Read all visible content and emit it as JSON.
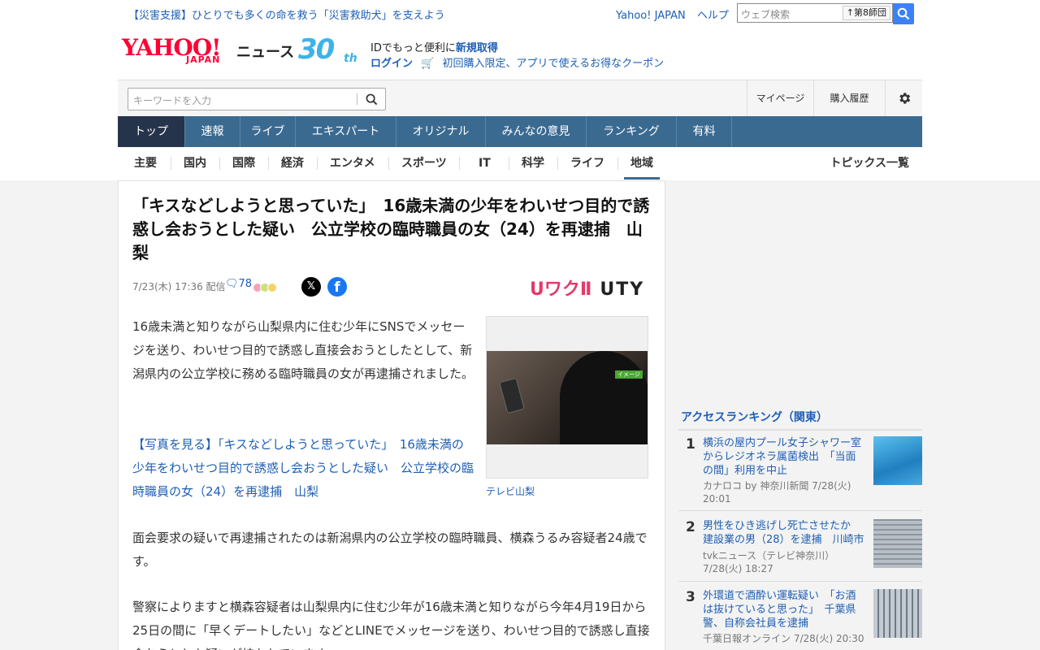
{
  "top_strip": {
    "disaster_link": "【災害支援】ひとりでも多くの命を救う「災害救助犬」を支えよう",
    "yahoo_japan_link": "Yahoo! JAPAN",
    "help_link": "ヘルプ",
    "web_search_placeholder": "ウェブ検索",
    "search_badge": "第8師団"
  },
  "logo": {
    "yahoo": "YAHOO!",
    "japan": "JAPAN",
    "news": "ニュース",
    "anniv_number": "30",
    "anniv_suffix": "th"
  },
  "account": {
    "id_text": "IDでもっと便利に",
    "new_register": "新規取得",
    "login": "ログイン",
    "coupon": "初回購入限定、アプリで使えるお得なクーポン"
  },
  "search_row": {
    "keyword_placeholder": "キーワードを入力",
    "mypage": "マイページ",
    "purchase_history": "購入履歴"
  },
  "main_nav": {
    "items": [
      {
        "label": "トップ",
        "active": true
      },
      {
        "label": "速報"
      },
      {
        "label": "ライブ"
      },
      {
        "label": "エキスパート"
      },
      {
        "label": "オリジナル"
      },
      {
        "label": "みんなの意見"
      },
      {
        "label": "ランキング"
      },
      {
        "label": "有料"
      }
    ]
  },
  "sub_nav": {
    "items": [
      {
        "label": "主要"
      },
      {
        "label": "国内"
      },
      {
        "label": "国際"
      },
      {
        "label": "経済"
      },
      {
        "label": "エンタメ"
      },
      {
        "label": "スポーツ"
      },
      {
        "label": "IT"
      },
      {
        "label": "科学"
      },
      {
        "label": "ライフ"
      },
      {
        "label": "地域",
        "active": true
      }
    ],
    "topics": "トピックス一覧"
  },
  "article": {
    "headline": "「キスなどしようと思っていた」　16歳未満の少年をわいせつ目的で誘惑し会おうとした疑い　公立学校の臨時職員の女（24）を再逮捕　山梨",
    "date": "7/23(木) 17:36",
    "distributed": "配信",
    "comment_count": "78",
    "provider_logo_a": "UワクⅡ",
    "provider_logo_b": "UTY",
    "paragraph1": "16歳未満と知りながら山梨県内に住む少年にSNSでメッセージを送り、わいせつ目的で誘惑し直接会おうとしたとして、新潟県内の公立学校に務める臨時職員の女が再逮捕されました。",
    "photo_link": "【写真を見る】「キスなどしようと思っていた」　16歳未満の少年をわいせつ目的で誘惑し会おうとした疑い　公立学校の臨時職員の女（24）を再逮捕　山梨",
    "paragraph2": "面会要求の疑いで再逮捕されたのは新潟県内の公立学校の臨時職員、横森うるみ容疑者24歳です。",
    "paragraph3": "警察によりますと横森容疑者は山梨県内に住む少年が16歳未満と知りながら今年4月19日から25日の間に「早くデートしたい」などとLINEでメッセージを送り、わいせつ目的で誘惑し直接会おうとした疑いが持たれています。",
    "photo_tag": "イメージ",
    "photo_caption": "テレビ山梨"
  },
  "ranking": {
    "title": "アクセスランキング（関東）",
    "items": [
      {
        "rank": "1",
        "title": "横浜の屋内プール女子シャワー室からレジオネラ属菌検出　「当面の間」利用を中止",
        "source": "カナロコ by 神奈川新聞 7/28(火)",
        "time": "20:01",
        "thumb_color": "#3aa0d8"
      },
      {
        "rank": "2",
        "title": "男性をひき逃げし死亡させたか　建設業の男（28）を逮捕　川崎市",
        "source": "tvkニュース（テレビ神奈川）",
        "time": "7/28(火) 18:27",
        "thumb_color": "#9aa4ad"
      },
      {
        "rank": "3",
        "title": "外環道で酒酔い運転疑い　「お酒は抜けていると思った」　千葉県警、自称会社員を逮捕",
        "source": "千葉日報オンライン 7/28(火) 20:30",
        "time": "",
        "thumb_color": "#7f8a95"
      }
    ]
  },
  "colors": {
    "link_blue": "#1e5fb4",
    "nav_blue": "#3b6a91",
    "nav_active": "#26344b",
    "yahoo_red": "#ff0033",
    "search_button": "#3b82f6"
  }
}
